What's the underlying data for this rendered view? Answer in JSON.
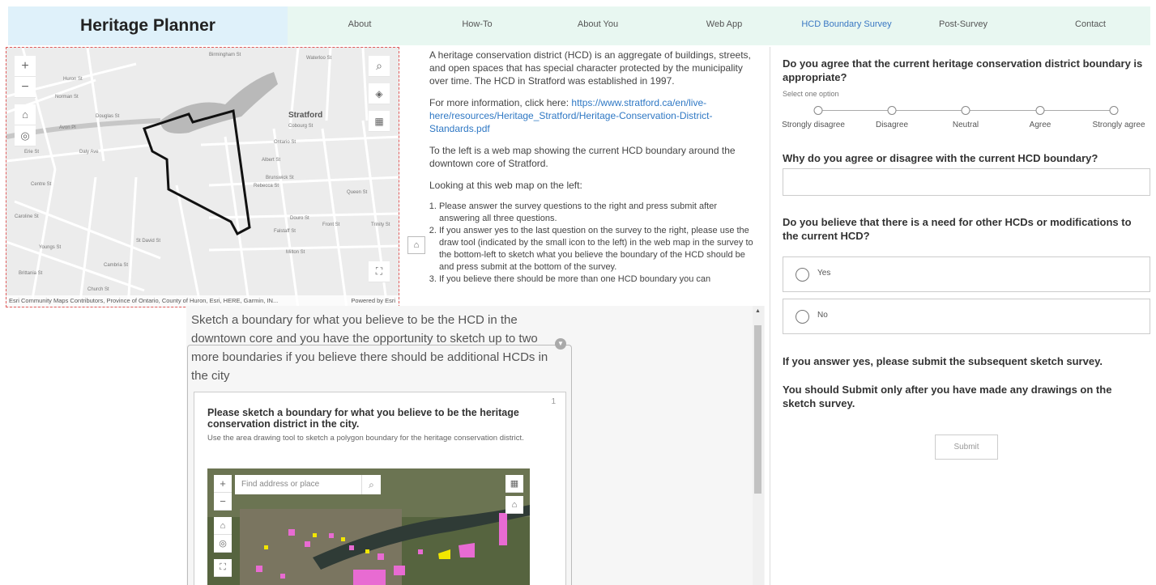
{
  "header": {
    "brand": "Heritage Planner",
    "nav": [
      {
        "label": "About",
        "active": false
      },
      {
        "label": "How-To",
        "active": false
      },
      {
        "label": "About You",
        "active": false
      },
      {
        "label": "Web App",
        "active": false
      },
      {
        "label": "HCD Boundary Survey",
        "active": true
      },
      {
        "label": "Post-Survey",
        "active": false
      },
      {
        "label": "Contact",
        "active": false
      }
    ]
  },
  "web_map": {
    "city_label": "Stratford",
    "street_labels": [
      "Cobourg St",
      "Ontario St",
      "Albert St",
      "Brunswick St",
      "Rebecca St",
      "Douro St",
      "Falstaff St",
      "Milton St",
      "Huron St",
      "Norman St",
      "Douglas St",
      "Avon Pl",
      "Erie St",
      "Daly Ave",
      "Centre St",
      "Caroline St",
      "Youngs St",
      "Brittania St",
      "St David St",
      "Front St",
      "Queen St",
      "Trinity St",
      "Waterloo St",
      "Cambria St",
      "Church St",
      "Birmingham St"
    ],
    "attribution": "Esri Community Maps Contributors, Province of Ontario, County of Huron, Esri, HERE, Garmin, IN...",
    "powered_by": "Powered by Esri"
  },
  "intro": {
    "p1": "A heritage conservation district (HCD) is an aggregate of buildings, streets, and open spaces that has special character protected by the municipality over time. The HCD in Stratford was established in 1997.",
    "p2_prefix": "For more information, click here: ",
    "p2_link": "https://www.stratford.ca/en/live-here/resources/Heritage_Stratford/Heritage-Conservation-District-Standards.pdf",
    "p3": "To the left is a web map showing the current HCD boundary around the downtown core of Stratford.",
    "p4": "Looking at this web map on the left:",
    "steps": [
      "Please answer the survey questions to the right and press submit after answering all three questions.",
      "If you answer yes to the last question on the survey to the right, please use the draw tool (indicated by the small icon to the left) in the web map in the survey to the bottom-left to sketch what you believe the boundary of the HCD should be and press submit at the bottom of the survey.",
      "If you believe there should be more than one HCD boundary you can"
    ]
  },
  "sketch": {
    "heading": "Sketch a boundary for what you believe to be the HCD in the downtown core and you have the opportunity to sketch up to two more boundaries if you believe there should be additional HCDs in the city",
    "card_number": "1",
    "card_title": "Please sketch a boundary for what you believe to be the heritage conservation district in the city.",
    "card_desc": "Use the area drawing tool to sketch a polygon boundary for the heritage conservation district.",
    "search_placeholder": "Find address or place"
  },
  "survey": {
    "q1": "Do you agree that the current heritage conservation district boundary is appropriate?",
    "q1_hint": "Select one option",
    "likert": [
      "Strongly disagree",
      "Disagree",
      "Neutral",
      "Agree",
      "Strongly agree"
    ],
    "q2": "Why do you agree or disagree with the current HCD boundary?",
    "q2_value": "",
    "q3": "Do you believe that there is a need for other HCDs or modifications to the current HCD?",
    "options": [
      "Yes",
      "No"
    ],
    "note1": "If you answer yes, please submit the subsequent sketch survey.",
    "note2": "You should Submit only after you have made any drawings on the sketch survey.",
    "submit": "Submit"
  },
  "icons": {
    "zoom_in": "plus-icon",
    "zoom_out": "minus-icon",
    "home": "home-icon",
    "locate": "locate-icon",
    "search": "search-icon",
    "layers": "layers-icon",
    "qr": "qr-code-icon",
    "fullscreen": "fullscreen-icon",
    "draw": "draw-polygon-icon"
  },
  "colors": {
    "brand_bg": "#dff1fa",
    "nav_bg": "#e8f7f1",
    "active_nav": "#3a78c3",
    "link": "#2f78c4",
    "hcd_boundary": "#111111",
    "sketch_pink": "#e86bd2",
    "sketch_yellow": "#f2e600"
  }
}
